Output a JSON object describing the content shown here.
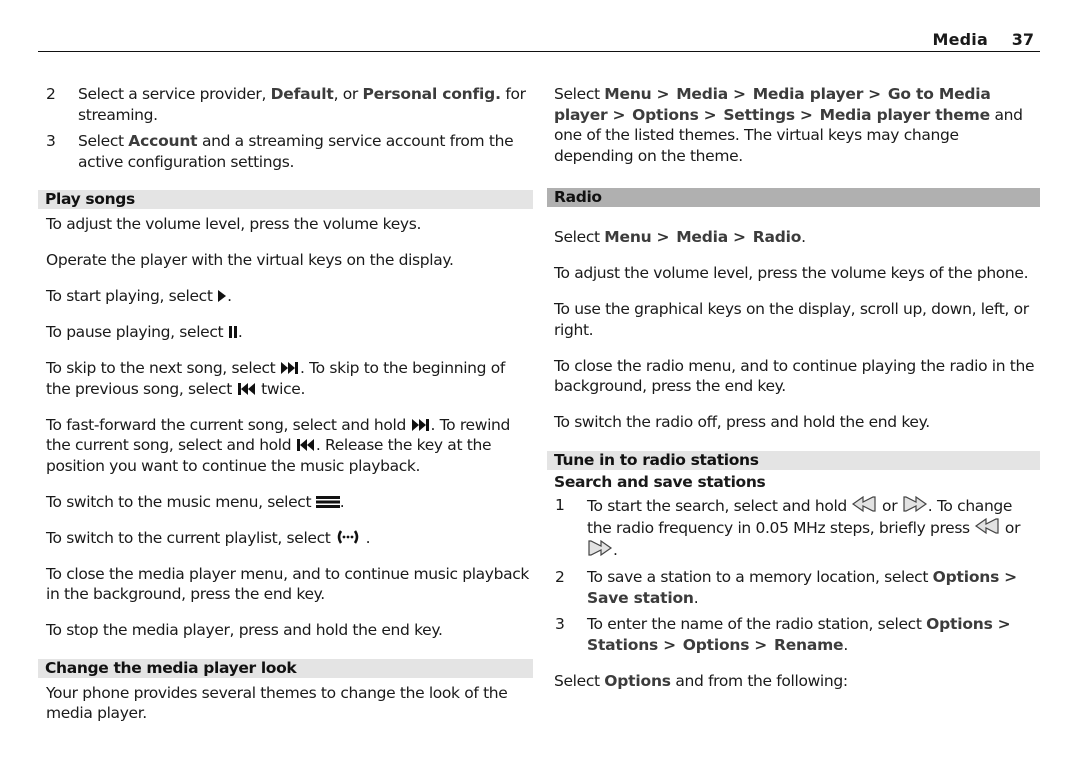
{
  "header": {
    "chapter": "Media",
    "page_number": "37"
  },
  "left": {
    "item2": {
      "num": "2",
      "pre": "Select a service provider, ",
      "opt1": "Default",
      "mid": ", or ",
      "opt2": "Personal config.",
      "post": " for streaming."
    },
    "item3": {
      "num": "3",
      "pre": "Select ",
      "opt": "Account",
      "post": " and a streaming service account from the active configuration settings."
    },
    "play_songs": {
      "title": "Play songs",
      "p1": "To adjust the volume level, press the volume keys.",
      "p2": "Operate the player with the virtual keys on the display.",
      "p3_pre": "To start playing, select ",
      "p3_post": ".",
      "p4_pre": "To pause playing, select ",
      "p4_post": ".",
      "p5_pre": "To skip to the next song, select ",
      "p5_mid": ". To skip to the beginning of the previous song, select ",
      "p5_post": " twice.",
      "p6_pre": "To fast-forward the current song, select and hold ",
      "p6_mid": ". To rewind the current song, select and hold ",
      "p6_post": ". Release the key at the position you want to continue the music playback.",
      "p7_pre": "To switch to the music menu, select ",
      "p7_post": ".",
      "p8_pre": "To switch to the current playlist, select ",
      "p8_post": " .",
      "p9": "To close the media player menu, and to continue music playback in the background, press the end key.",
      "p10": "To stop the media player, press and hold the end key."
    },
    "change_look": {
      "title": "Change the media player look",
      "p1": "Your phone provides several themes to change the look of the media player."
    }
  },
  "right": {
    "theme_path": {
      "pre": "Select ",
      "steps": [
        "Menu",
        "Media",
        "Media player",
        "Go to Media player",
        "Options",
        "Settings",
        "Media player theme"
      ],
      "separator": ">",
      "post": " and one of the listed themes. The virtual keys may change depending on the theme."
    },
    "radio": {
      "title": "Radio",
      "path_pre": "Select ",
      "path_steps": [
        "Menu",
        "Media",
        "Radio"
      ],
      "path_post": ".",
      "p1": "To adjust the volume level, press the volume keys of the phone.",
      "p2": "To use the graphical keys on the display, scroll up, down, left, or right.",
      "p3": "To close the radio menu, and to continue playing the radio in the background, press the end key.",
      "p4": "To switch the radio off, press and hold the end key."
    },
    "tune": {
      "title": "Tune in to radio stations",
      "subtitle": "Search and save stations",
      "item1": {
        "num": "1",
        "pre": "To start the search, select and hold ",
        "or1": " or ",
        "mid": ". To change the radio frequency in 0.05 MHz steps, briefly press ",
        "or2": " or ",
        "post": "."
      },
      "item2": {
        "num": "2",
        "pre": "To save a station to a memory location, select ",
        "steps": [
          "Options",
          "Save station"
        ],
        "post": "."
      },
      "item3": {
        "num": "3",
        "pre": "To enter the name of the radio station, select ",
        "steps": [
          "Options",
          "Stations",
          "Options",
          "Rename"
        ],
        "post": "."
      },
      "footer_pre": "Select ",
      "footer_opt": "Options",
      "footer_post": " and from the following:"
    }
  },
  "icons": {
    "play": "play-icon",
    "pause": "pause-icon",
    "next": "skip-forward-icon",
    "prev": "skip-back-icon",
    "menu": "music-menu-icon",
    "playlist": "playlist-icon",
    "seek_back": "seek-back-icon",
    "seek_fwd": "seek-forward-icon"
  }
}
